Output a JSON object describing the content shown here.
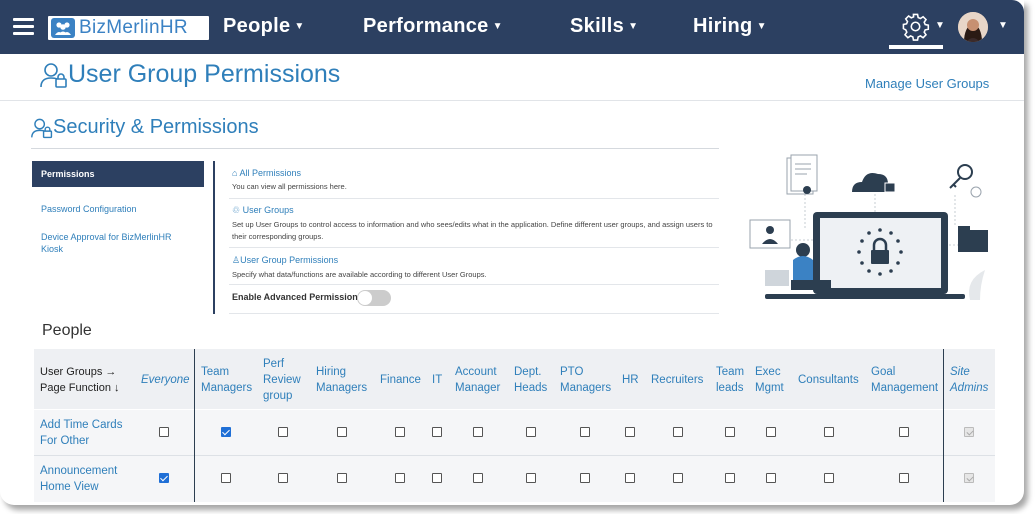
{
  "topbar": {
    "brand": "BizMerlinHR",
    "nav": [
      {
        "label": "People"
      },
      {
        "label": "Performance"
      },
      {
        "label": "Skills"
      },
      {
        "label": "Hiring"
      }
    ]
  },
  "header": {
    "title": "User Group Permissions",
    "manage_link": "Manage User Groups"
  },
  "section": {
    "title": "Security & Permissions"
  },
  "sidebar": {
    "items": [
      {
        "label": "Permissions",
        "active": true
      },
      {
        "label": "Password Configuration"
      },
      {
        "label": "Device Approval for BizMerlinHR Kiosk"
      }
    ]
  },
  "permissions": [
    {
      "title": "All Permissions",
      "icon": "lock-icon",
      "desc": "You can view all permissions here."
    },
    {
      "title": "User Groups",
      "icon": "user-groups-icon",
      "desc": "Set up User Groups to control access to information and who sees/edits what in the application. Define different user groups, and assign users to their corresponding groups."
    },
    {
      "title": "User Group Permissions",
      "icon": "user-lock-icon",
      "desc": "Specify what data/functions are available according to different User Groups."
    }
  ],
  "advanced": {
    "label": "Enable Advanced Permissions",
    "enabled": false
  },
  "grid": {
    "title": "People",
    "corner_label_1": "User Groups →",
    "corner_label_2": "Page Function ↓",
    "columns": [
      "Everyone",
      "Team Managers",
      "Perf Review group",
      "Hiring Managers",
      "Finance",
      "IT",
      "Account Manager",
      "Dept. Heads",
      "PTO Managers",
      "HR",
      "Recruiters",
      "Team leads",
      "Exec Mgmt",
      "Consultants",
      "Goal Management",
      "Site Admins"
    ],
    "rows": [
      {
        "label": "Add Time Cards For Other",
        "checked": [
          false,
          true,
          false,
          false,
          false,
          false,
          false,
          false,
          false,
          false,
          false,
          false,
          false,
          false,
          false,
          true
        ]
      },
      {
        "label": "Announcement Home View",
        "checked": [
          true,
          false,
          false,
          false,
          false,
          false,
          false,
          false,
          false,
          false,
          false,
          false,
          false,
          false,
          false,
          true
        ]
      }
    ]
  },
  "colors": {
    "navbar": "#2c4061",
    "link": "#2f7fba",
    "checkbox_on": "#1f6fd6"
  }
}
